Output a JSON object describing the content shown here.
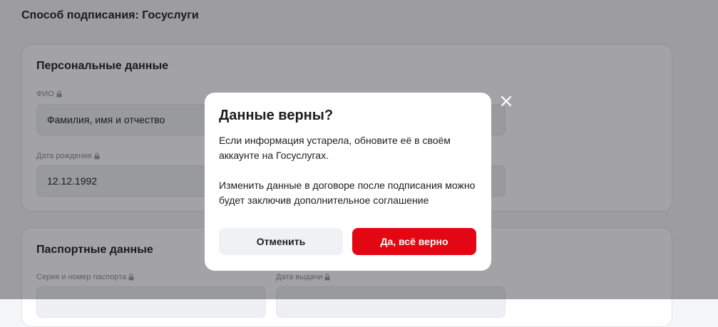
{
  "page": {
    "title": "Способ подписания: Госуслуги"
  },
  "personal": {
    "title": "Персональные данные",
    "fio_label": "ФИО",
    "fio_value": "Фамилия, имя и отчество",
    "birth_label": "Дата рождения",
    "birth_value": "12.12.1992"
  },
  "passport": {
    "title": "Паспортные данные",
    "series_label": "Серия и номер паспорта",
    "issue_label": "Дата выдачи"
  },
  "modal": {
    "title": "Данные верны?",
    "text_1": "Если информация устарела, обновите её в своём аккаунте на Госуслугах.",
    "text_2": "Изменить данные в договоре после подписания можно будет заключив дополнительное соглашение",
    "cancel_label": "Отменить",
    "confirm_label": "Да, всё верно"
  },
  "icons": {
    "lock": "lock-icon",
    "close": "close-icon"
  },
  "colors": {
    "accent": "#e30613",
    "overlay": "rgba(24,26,30,0.40)"
  }
}
